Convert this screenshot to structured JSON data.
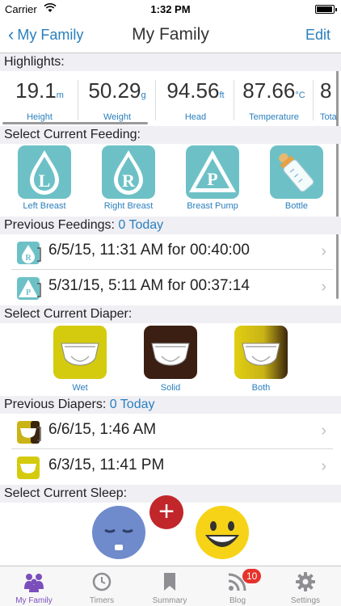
{
  "status": {
    "carrier": "Carrier",
    "time": "1:32 PM"
  },
  "nav": {
    "back_label": "My Family",
    "title": "My Family",
    "edit_label": "Edit"
  },
  "highlights": {
    "header": "Highlights:",
    "items": [
      {
        "value": "19.1",
        "unit": "m",
        "label": "Height"
      },
      {
        "value": "50.29",
        "unit": "g",
        "label": "Weight"
      },
      {
        "value": "94.56",
        "unit": "ft",
        "label": "Head"
      },
      {
        "value": "87.66",
        "unit": "°C",
        "label": "Temperature"
      },
      {
        "value": "8",
        "unit": "",
        "label": "Tota"
      }
    ]
  },
  "feeding": {
    "header": "Select Current Feeding:",
    "options": [
      {
        "letter": "L",
        "label": "Left Breast",
        "icon": "left-breast-drop-icon"
      },
      {
        "letter": "R",
        "label": "Right Breast",
        "icon": "right-breast-drop-icon"
      },
      {
        "letter": "P",
        "label": "Breast Pump",
        "icon": "breast-pump-triangle-icon"
      },
      {
        "letter": "",
        "label": "Bottle",
        "icon": "baby-bottle-icon"
      }
    ]
  },
  "previous_feedings": {
    "header": "Previous Feedings:",
    "today": "0 Today",
    "rows": [
      {
        "text": "6/5/15, 11:31 AM for 00:40:00",
        "icon_letter": "R"
      },
      {
        "text": "5/31/15, 5:11 AM for 00:37:14",
        "icon_letter": "P"
      }
    ]
  },
  "diaper": {
    "header": "Select Current Diaper:",
    "options": [
      {
        "label": "Wet",
        "color": "#d4cb0f"
      },
      {
        "label": "Solid",
        "color": "#3a1f12"
      },
      {
        "label": "Both",
        "color": "#c9b316"
      }
    ]
  },
  "previous_diapers": {
    "header": "Previous Diapers:",
    "today": "0 Today",
    "rows": [
      {
        "text": "6/6/15, 1:46 AM"
      },
      {
        "text": "6/3/15, 11:41 PM"
      }
    ]
  },
  "sleep": {
    "header": "Select Current Sleep:",
    "plus": "+"
  },
  "tabs": [
    {
      "label": "My Family",
      "icon": "family-icon",
      "active": true
    },
    {
      "label": "Timers",
      "icon": "clock-icon"
    },
    {
      "label": "Summary",
      "icon": "bookmark-icon"
    },
    {
      "label": "Blog",
      "icon": "rss-icon",
      "badge": "10"
    },
    {
      "label": "Settings",
      "icon": "gear-icon"
    }
  ],
  "colors": {
    "accent": "#2a7fbd",
    "teal": "#6dc1c6",
    "tab_active": "#7b4fbb",
    "badge": "#e5322b"
  }
}
